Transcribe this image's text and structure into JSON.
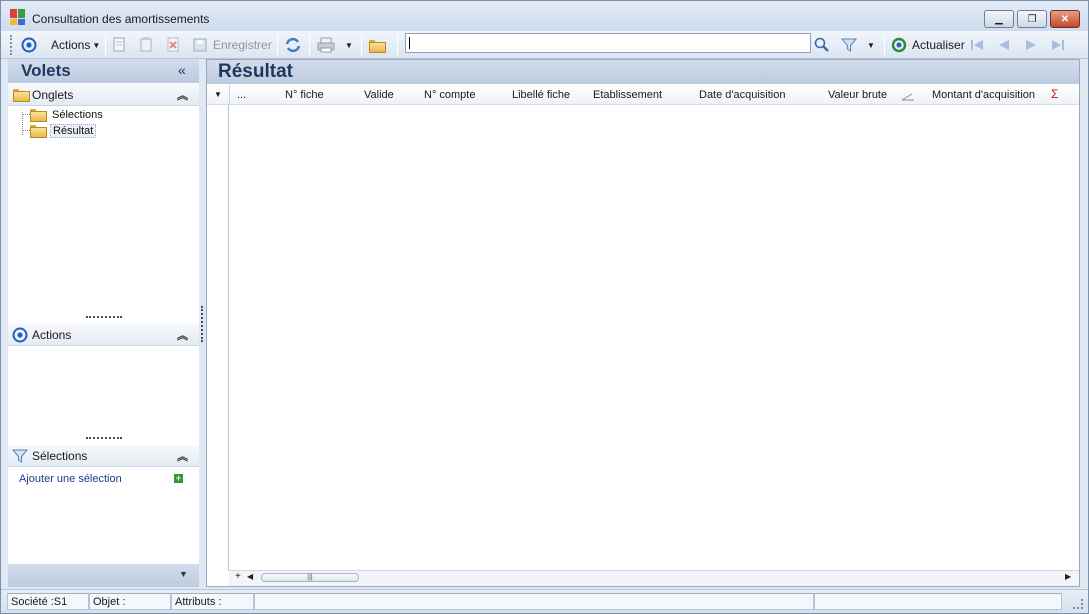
{
  "window": {
    "title": "Consultation des amortissements",
    "buttons": {
      "minimize": "▁",
      "maximize": "❐",
      "close": "✕"
    }
  },
  "toolbar": {
    "actions_label": "Actions",
    "save_label": "Enregistrer",
    "search_value": "",
    "refresh_label": "Actualiser"
  },
  "left_panel": {
    "title": "Volets",
    "collapse_glyph": "«",
    "onglets": {
      "title": "Onglets",
      "chevron": "⌃",
      "items": [
        {
          "label": "Sélections"
        },
        {
          "label": "Résultat"
        }
      ]
    },
    "actions": {
      "title": "Actions",
      "chevron": "⌃"
    },
    "selections": {
      "title": "Sélections",
      "chevron": "⌃",
      "add_link": "Ajouter une sélection",
      "add_glyph": "+"
    },
    "bottom_arrow": "▼"
  },
  "result_panel": {
    "title": "Résultat",
    "columns": [
      {
        "label": "..."
      },
      {
        "label": "N° fiche"
      },
      {
        "label": "Valide"
      },
      {
        "label": "N° compte"
      },
      {
        "label": "Libellé fiche"
      },
      {
        "label": "Etablissement"
      },
      {
        "label": "Date d'acquisition"
      },
      {
        "label": "Valeur brute"
      },
      {
        "label": "Montant d'acquisition"
      }
    ],
    "sigma": "Σ",
    "rows": [],
    "scroll_thumb": "|||"
  },
  "status_bar": {
    "societe": "Société :S1",
    "objet": "Objet :",
    "attributs": "Attributs :"
  }
}
